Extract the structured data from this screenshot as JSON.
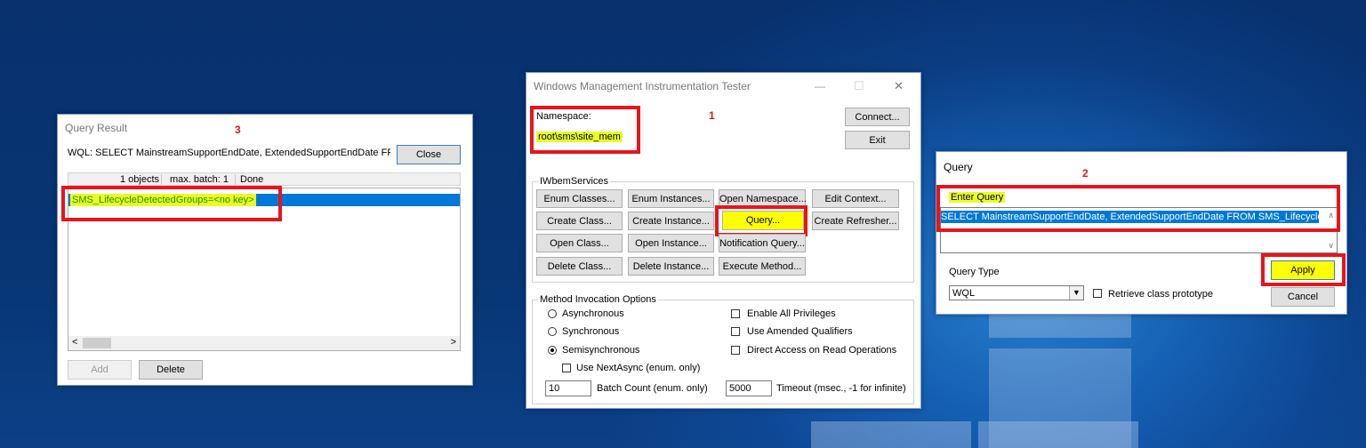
{
  "markers": [
    "1",
    "2",
    "3"
  ],
  "result_window": {
    "title": "Query Result",
    "wql_text": "WQL: SELECT MainstreamSupportEndDate, ExtendedSupportEndDate FROM SMS_LifecycleDetectedGroups",
    "close_label": "Close",
    "status": {
      "objects": "1 objects",
      "batch": "max. batch: 1",
      "state": "Done"
    },
    "rows": [
      "SMS_LifecycleDetectedGroups=<no key>"
    ],
    "scroll_left": "<",
    "scroll_right": ">",
    "add_label": "Add",
    "delete_label": "Delete"
  },
  "main_window": {
    "title": "Windows Management Instrumentation Tester",
    "controls": {
      "minimize": "—",
      "maximize": "☐",
      "close": "✕"
    },
    "namespace_label": "Namespace:",
    "namespace_value": "root\\sms\\site_mem",
    "connect_label": "Connect...",
    "exit_label": "Exit",
    "services_title": "IWbemServices",
    "buttons": [
      [
        "Enum Classes...",
        "Enum Instances...",
        "Open Namespace...",
        "Edit Context..."
      ],
      [
        "Create Class...",
        "Create Instance...",
        "Query...",
        "Create Refresher..."
      ],
      [
        "Open Class...",
        "Open Instance...",
        "Notification Query..."
      ],
      [
        "Delete Class...",
        "Delete Instance...",
        "Execute Method..."
      ]
    ],
    "options_title": "Method Invocation Options",
    "radios": [
      "Asynchronous",
      "Synchronous",
      "Semisynchronous"
    ],
    "checks": [
      "Enable All Privileges",
      "Use Amended Qualifiers",
      "Direct Access on Read Operations"
    ],
    "use_next_async": "Use NextAsync (enum. only)",
    "batch_value": "10",
    "batch_label": "Batch Count (enum. only)",
    "timeout_value": "5000",
    "timeout_label": "Timeout (msec., -1 for infinite)"
  },
  "query_window": {
    "title": "Query",
    "enter_query_label": "Enter Query",
    "query_text": "SELECT MainstreamSupportEndDate, ExtendedSupportEndDate FROM SMS_LifecycleDetectedGroups",
    "query_type_label": "Query Type",
    "query_type_value": "WQL",
    "retrieve_label": "Retrieve class prototype",
    "apply_label": "Apply",
    "cancel_label": "Cancel"
  }
}
